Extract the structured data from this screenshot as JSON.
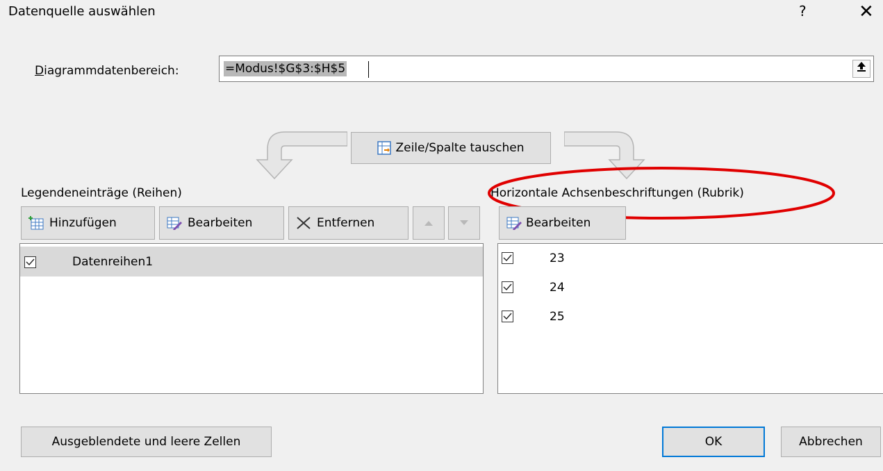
{
  "dialog": {
    "title": "Datenquelle auswählen",
    "help_glyph": "?",
    "close_glyph": "✕"
  },
  "range": {
    "label": "Diagrammdatenbereich:",
    "value": "=Modus!$G$3:$H$5"
  },
  "swap_button": {
    "label": "Zeile/Spalte tauschen"
  },
  "legend": {
    "label": "Legendeneinträge (Reihen)",
    "add_label": "Hinzufügen",
    "edit_label": "Bearbeiten",
    "remove_label": "Entfernen",
    "series": [
      {
        "name": "Datenreihen1",
        "checked": true,
        "selected": true
      }
    ]
  },
  "axis": {
    "label": "Horizontale Achsenbeschriftungen (Rubrik)",
    "edit_label": "Bearbeiten",
    "items": [
      {
        "value": "23",
        "checked": true
      },
      {
        "value": "24",
        "checked": true
      },
      {
        "value": "25",
        "checked": true
      }
    ],
    "highlight_color": "#e00000"
  },
  "footer": {
    "hidden_cells_label": "Ausgeblendete und leere Zellen",
    "ok_label": "OK",
    "cancel_label": "Abbrechen"
  }
}
